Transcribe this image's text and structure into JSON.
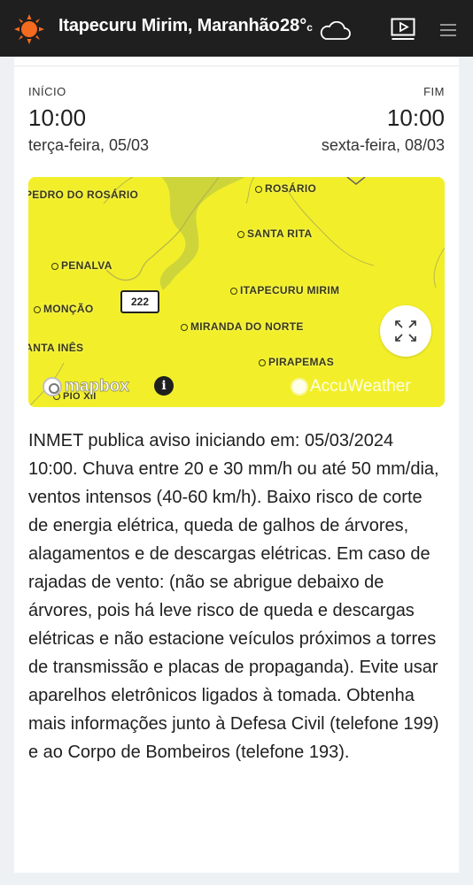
{
  "header": {
    "location": "Itapecuru Mirim, Maranhão",
    "temperature": "28°",
    "temperature_unit": "c",
    "icons": [
      "sun-icon",
      "cloud-icon",
      "video-icon",
      "menu-icon"
    ]
  },
  "alert": {
    "start_label": "INÍCIO",
    "end_label": "FIM",
    "start_time": "10:00",
    "end_time": "10:00",
    "start_date": "terça-feira, 05/03",
    "end_date": "sexta-feira, 08/03",
    "description": "INMET publica aviso iniciando em: 05/03/2024 10:00. Chuva entre 20 e 30 mm/h ou até 50 mm/dia, ventos intensos (40-60 km/h). Baixo risco de corte de energia elétrica, queda de galhos de árvores, alagamentos e de descargas elétricas. Em caso de rajadas de vento: (não se abrigue debaixo de árvores, pois há leve risco de queda e descargas elétricas e não estacione veículos próximos a torres de transmissão e placas de propaganda). Evite usar aparelhos eletrônicos ligados à tomada. Obtenha mais informações junto à Defesa Civil (telefone 199) e ao Corpo de Bombeiros (telefone 193)."
  },
  "map": {
    "labels": {
      "pedro_do_rosario": "PEDRO DO ROSÁRIO",
      "rosario": "ROSÁRIO",
      "santa_rita": "SANTA RITA",
      "penalva": "PENALVA",
      "itapecuru_mirim": "ITAPECURU MIRIM",
      "moncao": "MONÇÃO",
      "miranda_do_norte": "MIRANDA DO NORTE",
      "santa_ines": "SANTA INÊS",
      "pirapemas": "PIRAPEMAS",
      "pio_xii": "PIO XII",
      "road_shield": "222"
    },
    "mapbox_text": "mapbox",
    "info_symbol": "i",
    "accuweather_text": "AccuWeather",
    "fill_color": "#f2ef2a"
  },
  "colors": {
    "header_bg": "#1f1f1f",
    "page_bg": "#eef1f4",
    "card_bg": "#ffffff",
    "sun": "#f46a1f"
  }
}
